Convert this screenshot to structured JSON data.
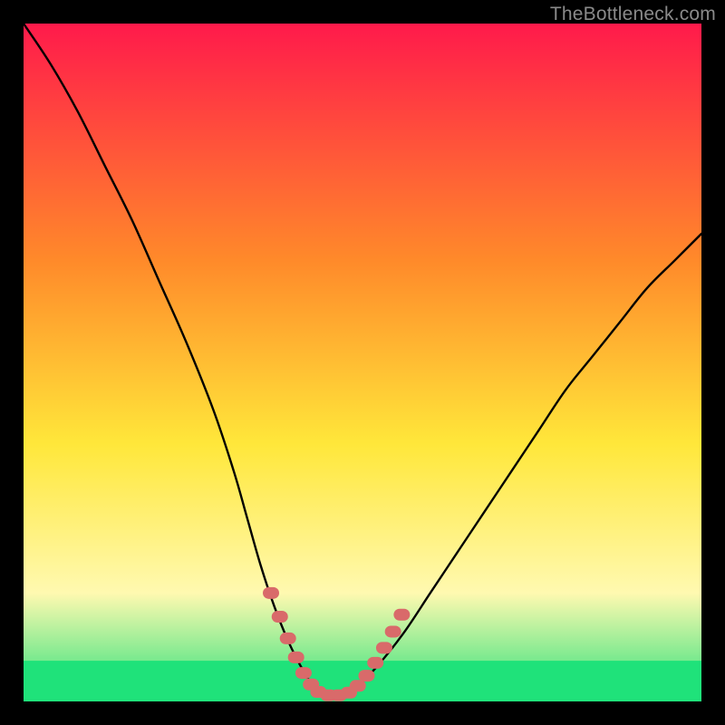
{
  "watermark": "TheBottleneck.com",
  "chart_data": {
    "type": "line",
    "title": "",
    "xlabel": "",
    "ylabel": "",
    "xlim": [
      0,
      100
    ],
    "ylim": [
      0,
      100
    ],
    "background_gradient": {
      "top": "#ff1a4b",
      "mid1": "#ff8a2a",
      "mid2": "#ffe73a",
      "mid3": "#fff9b0",
      "bottom": "#27e07a"
    },
    "green_band_y_range": [
      0,
      6
    ],
    "series": [
      {
        "name": "bottleneck-curve",
        "stroke": "#000000",
        "x": [
          0,
          4,
          8,
          12,
          16,
          20,
          24,
          28,
          31,
          33,
          35,
          37,
          39,
          41,
          43,
          45,
          47,
          49,
          52,
          56,
          60,
          64,
          68,
          72,
          76,
          80,
          84,
          88,
          92,
          96,
          100
        ],
        "y": [
          100,
          94,
          87,
          79,
          71,
          62,
          53,
          43,
          34,
          27,
          20,
          14,
          9,
          5,
          2,
          1,
          1,
          2,
          5,
          10,
          16,
          22,
          28,
          34,
          40,
          46,
          51,
          56,
          61,
          65,
          69
        ]
      }
    ],
    "marker_segments": [
      {
        "name": "left-descent-markers",
        "color": "#d96a6a",
        "points": [
          {
            "x": 36.5,
            "y": 16
          },
          {
            "x": 37.8,
            "y": 12.5
          },
          {
            "x": 39.0,
            "y": 9.3
          },
          {
            "x": 40.2,
            "y": 6.5
          },
          {
            "x": 41.3,
            "y": 4.2
          },
          {
            "x": 42.4,
            "y": 2.5
          }
        ]
      },
      {
        "name": "valley-floor-markers",
        "color": "#d96a6a",
        "points": [
          {
            "x": 43.5,
            "y": 1.4
          },
          {
            "x": 45.0,
            "y": 0.9
          },
          {
            "x": 46.5,
            "y": 0.9
          },
          {
            "x": 48.0,
            "y": 1.3
          }
        ]
      },
      {
        "name": "right-ascent-markers",
        "color": "#d96a6a",
        "points": [
          {
            "x": 49.3,
            "y": 2.3
          },
          {
            "x": 50.6,
            "y": 3.8
          },
          {
            "x": 51.9,
            "y": 5.7
          },
          {
            "x": 53.2,
            "y": 7.9
          },
          {
            "x": 54.5,
            "y": 10.3
          },
          {
            "x": 55.8,
            "y": 12.8
          }
        ]
      }
    ]
  }
}
